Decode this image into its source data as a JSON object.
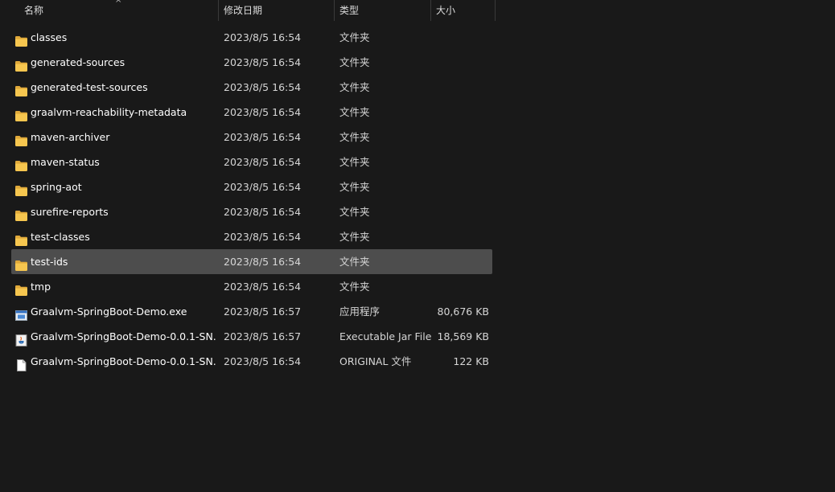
{
  "columns": {
    "name": "名称",
    "modified": "修改日期",
    "type": "类型",
    "size": "大小"
  },
  "colors": {
    "background": "#191919",
    "selected_row": "#4d4d4d",
    "folder_icon": "#f3c24b",
    "text": "#ffffff"
  },
  "files": [
    {
      "name": "classes",
      "date": "2023/8/5 16:54",
      "type": "文件夹",
      "size": "",
      "icon": "folder-icon"
    },
    {
      "name": "generated-sources",
      "date": "2023/8/5 16:54",
      "type": "文件夹",
      "size": "",
      "icon": "folder-icon"
    },
    {
      "name": "generated-test-sources",
      "date": "2023/8/5 16:54",
      "type": "文件夹",
      "size": "",
      "icon": "folder-icon"
    },
    {
      "name": "graalvm-reachability-metadata",
      "date": "2023/8/5 16:54",
      "type": "文件夹",
      "size": "",
      "icon": "folder-icon"
    },
    {
      "name": "maven-archiver",
      "date": "2023/8/5 16:54",
      "type": "文件夹",
      "size": "",
      "icon": "folder-icon"
    },
    {
      "name": "maven-status",
      "date": "2023/8/5 16:54",
      "type": "文件夹",
      "size": "",
      "icon": "folder-icon"
    },
    {
      "name": "spring-aot",
      "date": "2023/8/5 16:54",
      "type": "文件夹",
      "size": "",
      "icon": "folder-icon"
    },
    {
      "name": "surefire-reports",
      "date": "2023/8/5 16:54",
      "type": "文件夹",
      "size": "",
      "icon": "folder-icon"
    },
    {
      "name": "test-classes",
      "date": "2023/8/5 16:54",
      "type": "文件夹",
      "size": "",
      "icon": "folder-icon"
    },
    {
      "name": "test-ids",
      "date": "2023/8/5 16:54",
      "type": "文件夹",
      "size": "",
      "icon": "folder-icon",
      "selected": true
    },
    {
      "name": "tmp",
      "date": "2023/8/5 16:54",
      "type": "文件夹",
      "size": "",
      "icon": "folder-icon"
    },
    {
      "name": "Graalvm-SpringBoot-Demo.exe",
      "date": "2023/8/5 16:57",
      "type": "应用程序",
      "size": "80,676 KB",
      "icon": "exe-icon"
    },
    {
      "name": "Graalvm-SpringBoot-Demo-0.0.1-SN...",
      "date": "2023/8/5 16:57",
      "type": "Executable Jar File",
      "size": "18,569 KB",
      "icon": "jar-icon"
    },
    {
      "name": "Graalvm-SpringBoot-Demo-0.0.1-SN...",
      "date": "2023/8/5 16:54",
      "type": "ORIGINAL 文件",
      "size": "122 KB",
      "icon": "file-icon"
    }
  ]
}
